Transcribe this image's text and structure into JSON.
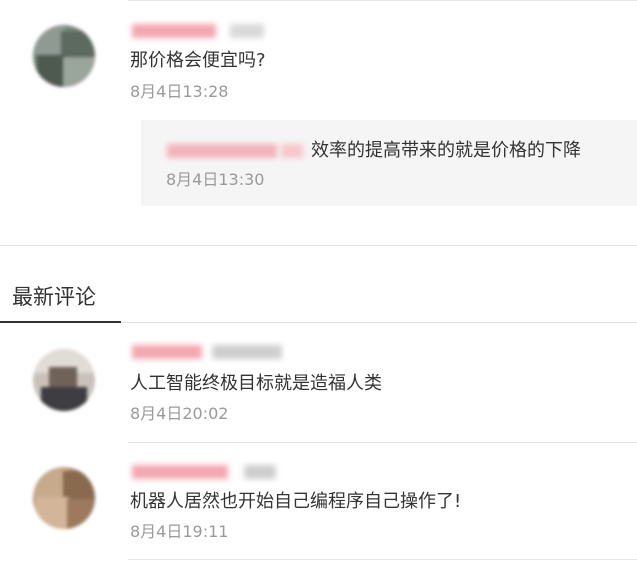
{
  "colors": {
    "text": "#333333",
    "time": "#9a9a9a",
    "reply_bg": "#f5f5f5",
    "divider": "#e8e8e8",
    "redacted_name": "#f4a6b0"
  },
  "top_comment": {
    "text": "那价格会便宜吗?",
    "time": "8月4日13:28",
    "reply": {
      "text": "效率的提高带来的就是价格的下降",
      "time": "8月4日13:30"
    }
  },
  "section": {
    "title": "最新评论"
  },
  "comments": [
    {
      "text": "人工智能终极目标就是造福人类",
      "time": "8月4日20:02"
    },
    {
      "text": "机器人居然也开始自己编程序自己操作了!",
      "time": "8月4日19:11"
    }
  ]
}
